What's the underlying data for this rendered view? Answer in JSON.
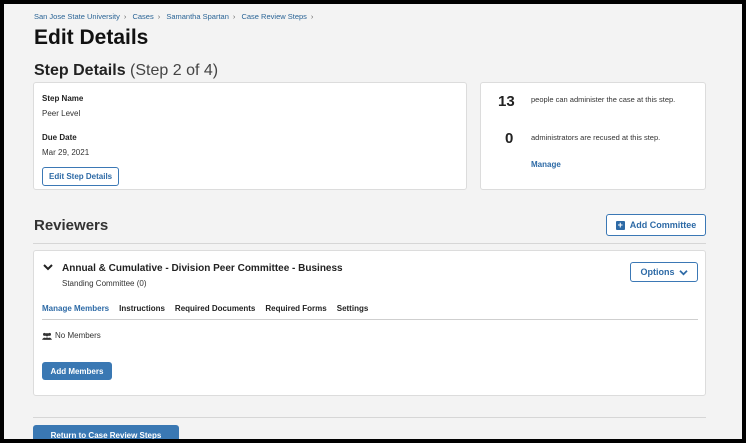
{
  "breadcrumb": [
    "San Jose State University",
    "Cases",
    "Samantha Spartan",
    "Case Review Steps"
  ],
  "page_title": "Edit Details",
  "section": {
    "title": "Step Details",
    "subtitle": "(Step 2 of 4)"
  },
  "step_details": {
    "step_name_label": "Step Name",
    "step_name_value": "Peer Level",
    "due_date_label": "Due Date",
    "due_date_value": "Mar 29, 2021",
    "edit_button": "Edit Step Details"
  },
  "admins": {
    "count_admins": "13",
    "admins_text": "people can administer the case at this step.",
    "count_recused": "0",
    "recused_text": "administrators are recused at this step.",
    "manage_link": "Manage"
  },
  "reviewers": {
    "title": "Reviewers",
    "add_committee": "Add Committee"
  },
  "committee": {
    "name": "Annual & Cumulative - Division Peer Committee - Business",
    "type": "Standing Committee (0)",
    "options": "Options",
    "tabs": [
      "Manage Members",
      "Instructions",
      "Required Documents",
      "Required Forms",
      "Settings"
    ],
    "no_members": "No Members",
    "add_members": "Add Members"
  },
  "footer": {
    "return_button": "Return to Case Review Steps"
  }
}
